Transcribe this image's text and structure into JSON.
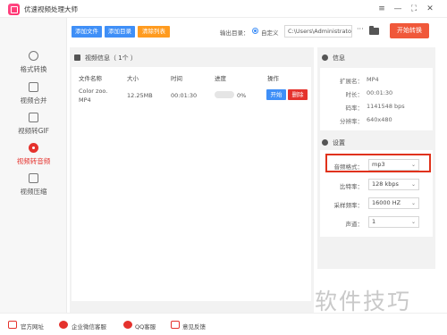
{
  "window": {
    "title": "优速视频处理大师",
    "controls": [
      "≡",
      "—",
      "⛶",
      "✕"
    ]
  },
  "sidebar": {
    "items": [
      {
        "label": "格式转换",
        "icon": "format-convert-icon"
      },
      {
        "label": "视频合并",
        "icon": "video-merge-icon"
      },
      {
        "label": "视频转GIF",
        "icon": "video-to-gif-icon"
      },
      {
        "label": "视频转音频",
        "icon": "video-to-audio-icon",
        "active": true
      },
      {
        "label": "视频压缩",
        "icon": "video-compress-icon"
      }
    ]
  },
  "toolbar": {
    "add_file": "添加文件",
    "add_folder": "添加目录",
    "clear_list": "清除列表",
    "output_label": "输出目录：",
    "radio_custom": "自定义",
    "output_path": "C:\\Users\\Administrato",
    "browse": "···",
    "start_convert": "开始转换"
  },
  "file_panel": {
    "header": "视频信息（ 1个 ）",
    "columns": [
      "文件名称",
      "大小",
      "时间",
      "进度",
      "操作"
    ],
    "rows": [
      {
        "name_line1": "Color zoo.",
        "name_line2": "MP4",
        "size": "12.25MB",
        "time": "00:01:30",
        "progress_text": "0%",
        "progress": 0,
        "start": "开始",
        "delete": "删除"
      }
    ]
  },
  "info_panel": {
    "header": "信息",
    "fields": [
      {
        "label": "扩展名：",
        "value": "MP4"
      },
      {
        "label": "时长：",
        "value": "00:01:30"
      },
      {
        "label": "码率：",
        "value": "1141548 bps"
      },
      {
        "label": "分辨率：",
        "value": "640x480"
      }
    ]
  },
  "settings_panel": {
    "header": "设置",
    "fields": [
      {
        "label": "音频格式：",
        "value": "mp3"
      },
      {
        "label": "比特率：",
        "value": "128 kbps"
      },
      {
        "label": "采样频率：",
        "value": "16000 HZ"
      },
      {
        "label": "声道：",
        "value": "1"
      }
    ]
  },
  "bottom_bar": {
    "links": [
      "官方网址",
      "企业微信客服",
      "QQ客服",
      "意见反馈"
    ]
  },
  "watermark": "软件技巧",
  "colors": {
    "accent_blue": "#3f8ff7",
    "accent_orange": "#ff9b1f",
    "accent_red": "#e5322d",
    "start_convert": "#f0583a"
  }
}
